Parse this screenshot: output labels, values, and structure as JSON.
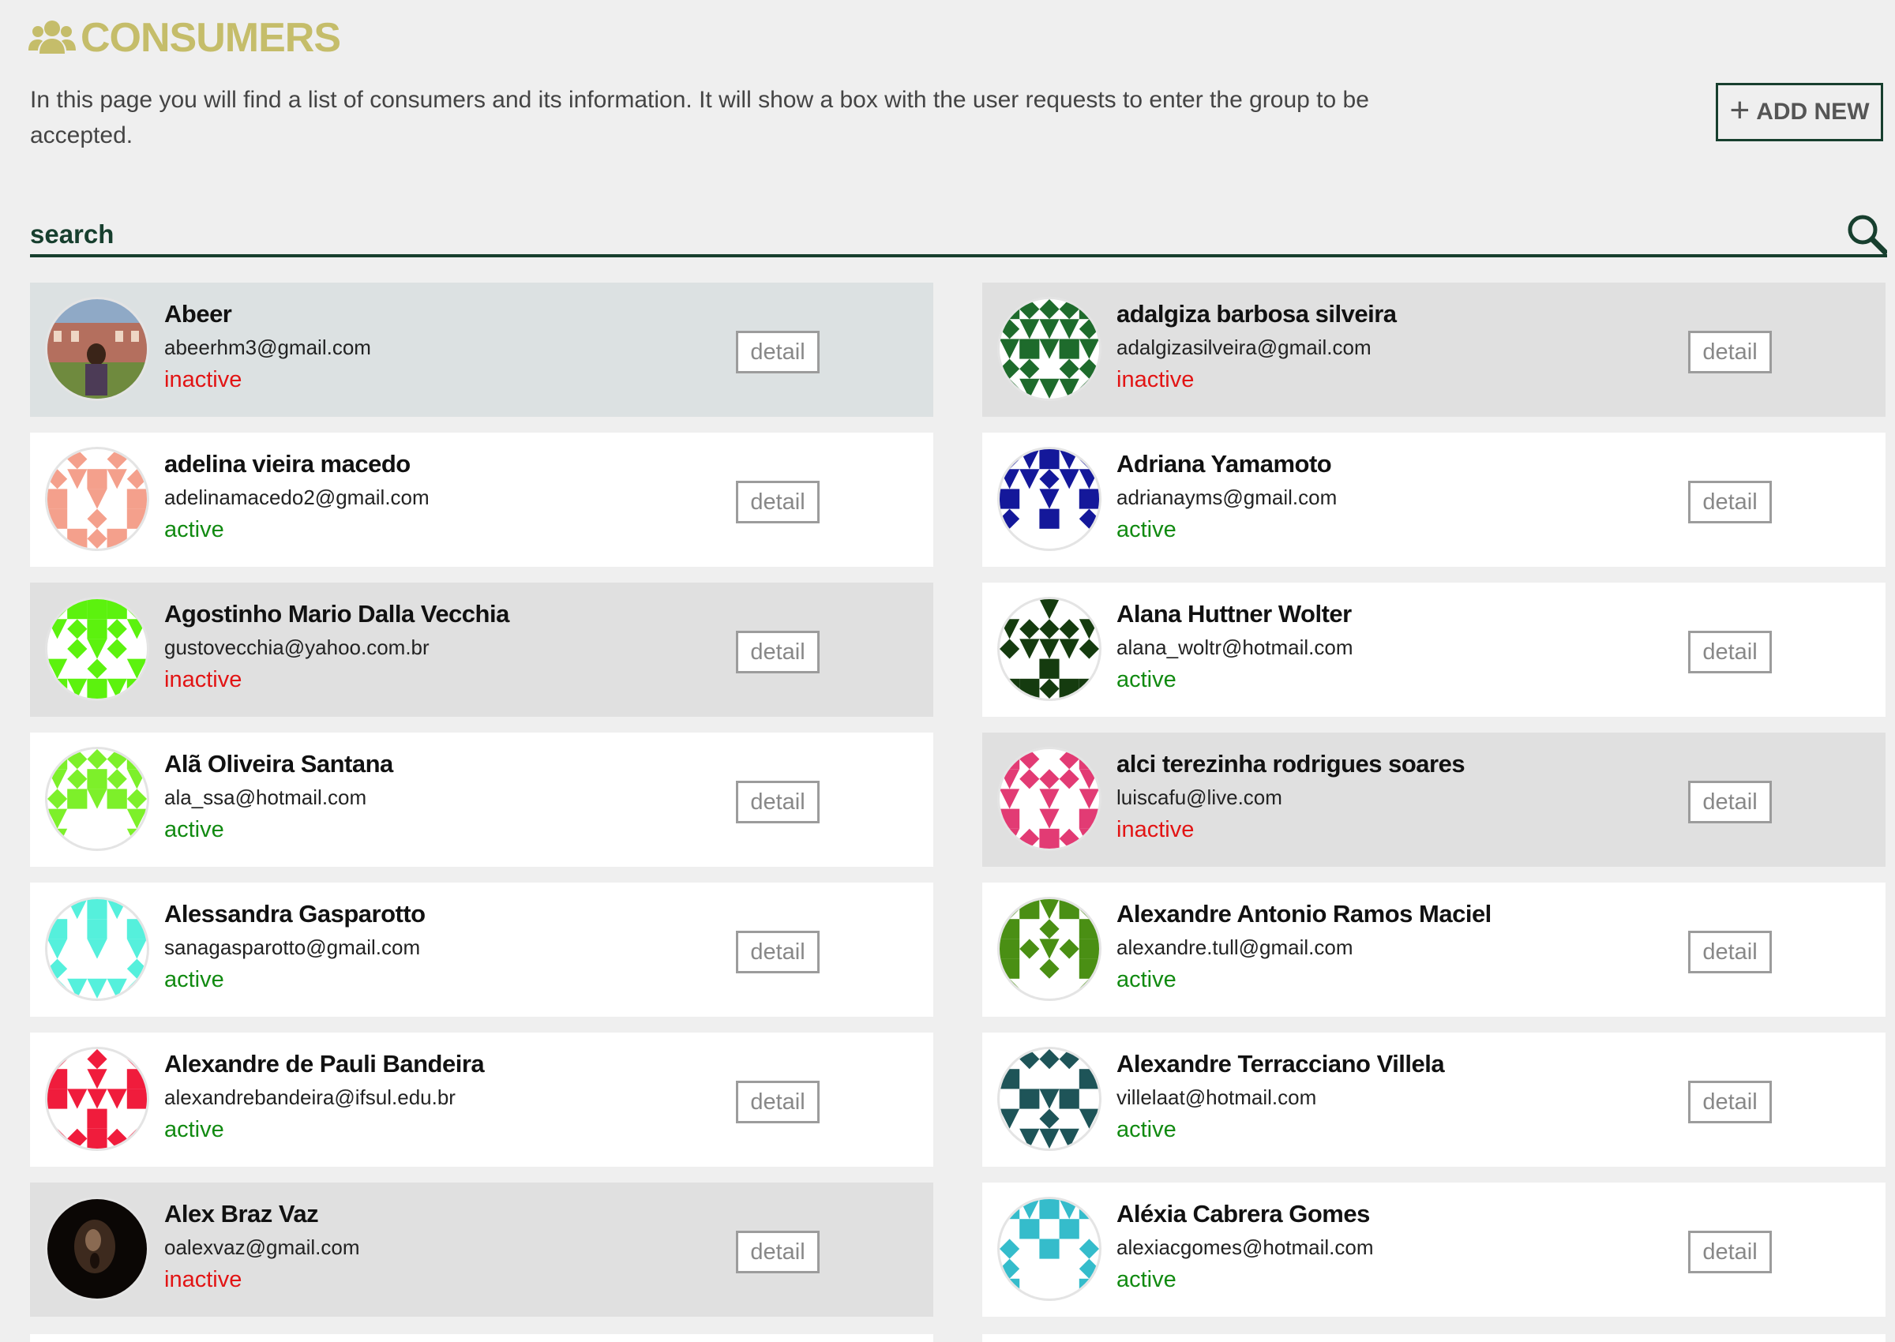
{
  "page": {
    "title": "CONSUMERS",
    "title_icon": "users-icon",
    "accent_color": "#c5bd6a",
    "brand_color": "#173f2e",
    "description": "In this page you will find a list of consumers and its information. It will show a box with the user requests to enter the group to be accepted."
  },
  "toolbar": {
    "add_new_label": "ADD NEW",
    "add_new_icon": "plus-icon"
  },
  "search": {
    "placeholder": "search",
    "value": "",
    "icon": "magnifier-icon"
  },
  "consumers": [
    {
      "name": "Abeer",
      "email": "abeerhm3@gmail.com",
      "status": "inactive",
      "detail_label": "detail",
      "avatar": "photo-woman-building",
      "bg": "blue"
    },
    {
      "name": "adalgiza barbosa silveira",
      "email": "adalgizasilveira@gmail.com",
      "status": "inactive",
      "detail_label": "detail",
      "avatar": "identicon",
      "bg": "gray",
      "color": "#1e6b2c"
    },
    {
      "name": "adelina vieira macedo",
      "email": "adelinamacedo2@gmail.com",
      "status": "active",
      "detail_label": "detail",
      "avatar": "identicon",
      "bg": "white",
      "color": "#f4a08c"
    },
    {
      "name": "Adriana Yamamoto",
      "email": "adrianayms@gmail.com",
      "status": "active",
      "detail_label": "detail",
      "avatar": "identicon",
      "bg": "white",
      "color": "#14189a"
    },
    {
      "name": "Agostinho Mario Dalla Vecchia",
      "email": "gustovecchia@yahoo.com.br",
      "status": "inactive",
      "detail_label": "detail",
      "avatar": "identicon",
      "bg": "gray",
      "color": "#5cf20e"
    },
    {
      "name": "Alana Huttner Wolter",
      "email": "alana_woltr@hotmail.com",
      "status": "active",
      "detail_label": "detail",
      "avatar": "identicon",
      "bg": "white",
      "color": "#153b0f"
    },
    {
      "name": "Alã Oliveira Santana",
      "email": "ala_ssa@hotmail.com",
      "status": "active",
      "detail_label": "detail",
      "avatar": "identicon",
      "bg": "white",
      "color": "#7df02a"
    },
    {
      "name": "alci terezinha rodrigues soares",
      "email": "luiscafu@live.com",
      "status": "inactive",
      "detail_label": "detail",
      "avatar": "identicon",
      "bg": "gray",
      "color": "#e23b74"
    },
    {
      "name": "Alessandra Gasparotto",
      "email": "sanagasparotto@gmail.com",
      "status": "active",
      "detail_label": "detail",
      "avatar": "identicon",
      "bg": "white",
      "color": "#55f0dc"
    },
    {
      "name": "Alexandre Antonio Ramos Maciel",
      "email": "alexandre.tull@gmail.com",
      "status": "active",
      "detail_label": "detail",
      "avatar": "identicon",
      "bg": "white",
      "color": "#4a8f14"
    },
    {
      "name": "Alexandre de Pauli Bandeira",
      "email": "alexandrebandeira@ifsul.edu.br",
      "status": "active",
      "detail_label": "detail",
      "avatar": "identicon",
      "bg": "white",
      "color": "#f01c3c"
    },
    {
      "name": "Alexandre Terracciano Villela",
      "email": "villelaat@hotmail.com",
      "status": "active",
      "detail_label": "detail",
      "avatar": "identicon",
      "bg": "white",
      "color": "#1e5458"
    },
    {
      "name": "Alex Braz Vaz",
      "email": "oalexvaz@gmail.com",
      "status": "inactive",
      "detail_label": "detail",
      "avatar": "photo-dark-face",
      "bg": "gray"
    },
    {
      "name": "Aléxia Cabrera Gomes",
      "email": "alexiacgomes@hotmail.com",
      "status": "active",
      "detail_label": "detail",
      "avatar": "identicon",
      "bg": "white",
      "color": "#35bccb"
    }
  ]
}
